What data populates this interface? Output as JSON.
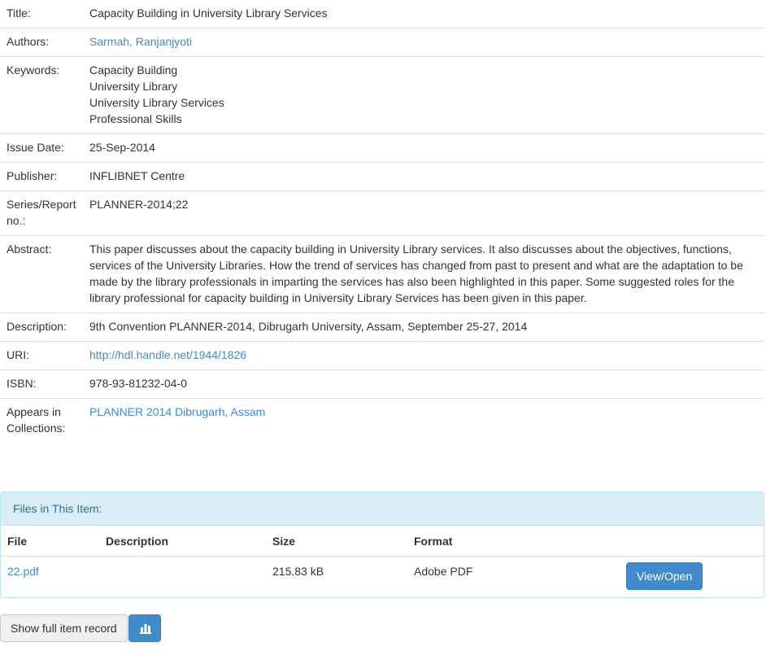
{
  "metadata": {
    "title_label": "Title:",
    "title_value": "Capacity Building in University Library Services",
    "authors_label": "Authors:",
    "authors_value": "Sarmah, Ranjanjyoti",
    "keywords_label": "Keywords:",
    "keywords": [
      "Capacity Building",
      "University Library",
      "University Library Services",
      "Professional Skills"
    ],
    "issue_date_label": "Issue Date:",
    "issue_date_value": "25-Sep-2014",
    "publisher_label": "Publisher:",
    "publisher_value": "INFLIBNET Centre",
    "series_label_1": "Series/Report",
    "series_label_2": "no.:",
    "series_value": "PLANNER-2014;22",
    "abstract_label": "Abstract:",
    "abstract_value": "This paper discusses about the capacity building in University Library services. It also discusses about the objectives, functions, services of the University Libraries. How the trend of services has changed from past to present and what are the adaptation to be made by the library professionals in imparting the services has also been highlighted in this paper. Some suggested roles for the library professional for capacity building in University Library Services has been given in this paper.",
    "description_label": "Description:",
    "description_value": "9th Convention PLANNER-2014, Dibrugarh University, Assam, September 25-27, 2014",
    "uri_label": "URI:",
    "uri_value": "http://hdl.handle.net/1944/1826",
    "isbn_label": "ISBN:",
    "isbn_value": "978-93-81232-04-0",
    "collections_label_1": "Appears in",
    "collections_label_2": "Collections:",
    "collections_value": "PLANNER 2014 Dibrugarh, Assam"
  },
  "files": {
    "heading": "Files in This Item:",
    "columns": [
      "File",
      "Description",
      "Size",
      "Format"
    ],
    "rows": [
      {
        "file": "22.pdf",
        "description": "",
        "size": "215.83 kB",
        "format": "Adobe PDF",
        "action": "View/Open"
      }
    ]
  },
  "actions": {
    "full_record_label": "Show full item record",
    "stats_icon": "bar-chart-icon"
  },
  "colors": {
    "link": "#428bca",
    "primary": "#428bca",
    "panel_heading_bg": "#d9edf7",
    "panel_heading_text": "#31708f"
  }
}
